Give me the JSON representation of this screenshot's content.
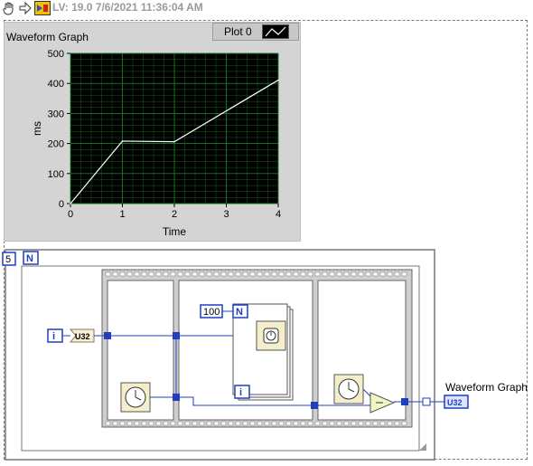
{
  "toolbar": {
    "version_text": "LV: 19.0 7/6/2021 11:36:04 AM",
    "icons": [
      "hand-icon",
      "arrow-icon",
      "labview-icon"
    ]
  },
  "front_panel": {
    "graph_label": "Waveform Graph",
    "legend_plot_name": "Plot 0",
    "plot_background_color": "#000000",
    "grid_color": "#1a7a2a",
    "trace_color": "#ffffff"
  },
  "chart_data": {
    "type": "line",
    "title": "Waveform Graph",
    "xlabel": "Time",
    "ylabel": "ms",
    "xlim": [
      0,
      4
    ],
    "ylim": [
      0,
      500
    ],
    "xticks": [
      "0",
      "1",
      "2",
      "3",
      "4"
    ],
    "yticks": [
      "0",
      "100",
      "200",
      "300",
      "400",
      "500"
    ],
    "grid": true,
    "series": [
      {
        "name": "Plot 0",
        "x": [
          0,
          1,
          2,
          4
        ],
        "y": [
          0,
          208,
          206,
          411
        ]
      }
    ]
  },
  "block_diagram": {
    "loop_count_constant": "5",
    "loop_count_terminal": "N",
    "iteration_terminal": "i",
    "convert_node": "U32",
    "inner_loop_count_constant": "100",
    "inner_loop_count_terminal": "N",
    "inner_iteration_terminal": "i",
    "indicator_type_label": "U32",
    "indicator_label": "Waveform Graph",
    "wire_color": "#1f3fbf"
  }
}
